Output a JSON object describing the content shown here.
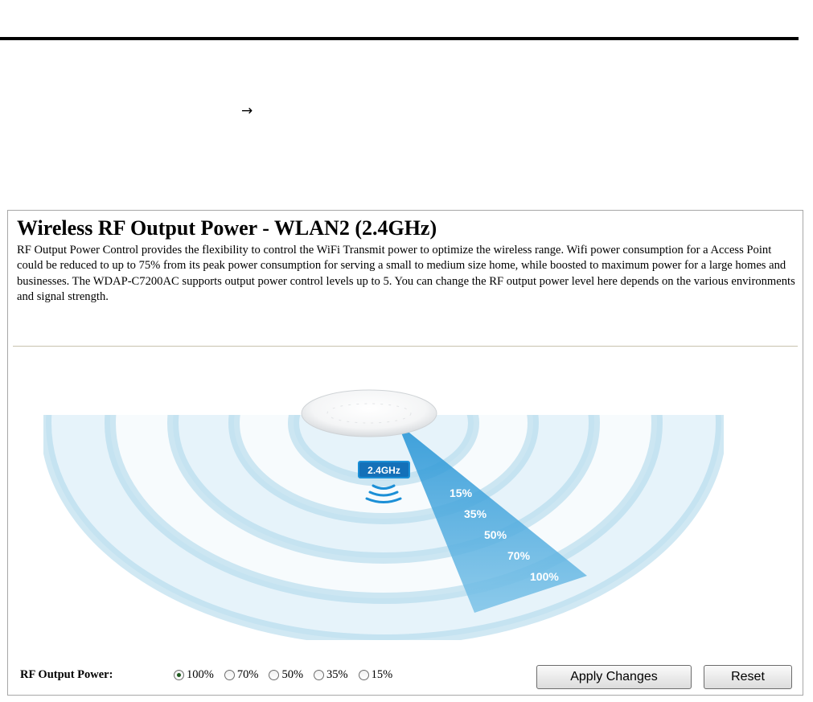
{
  "breadcrumb": {
    "arrow": "→"
  },
  "page": {
    "title": "Wireless RF Output Power - WLAN2 (2.4GHz)",
    "description": "RF Output Power Control provides the flexibility to control the WiFi Transmit power to optimize the wireless range. Wifi power consumption for a Access Point could be reduced to up to 75% from its peak power consumption for serving a small to medium size home, while boosted to maximum power for a large homes and businesses. The WDAP-C7200AC supports output power control levels up to 5. You can change the RF output power level here depends on the various environments and signal strength."
  },
  "illustration": {
    "band_badge": "2.4GHz",
    "levels": [
      "15%",
      "35%",
      "50%",
      "70%",
      "100%"
    ],
    "colors": {
      "ring_light": "#e6f3fa",
      "ring_dark": "#a9d5ea",
      "beam": "#2f9ed9",
      "badge": "#1b8fd6"
    }
  },
  "form": {
    "label": "RF Output Power:",
    "options": [
      "100%",
      "70%",
      "50%",
      "35%",
      "15%"
    ],
    "selected": "100%",
    "apply_label": "Apply Changes",
    "reset_label": "Reset"
  }
}
